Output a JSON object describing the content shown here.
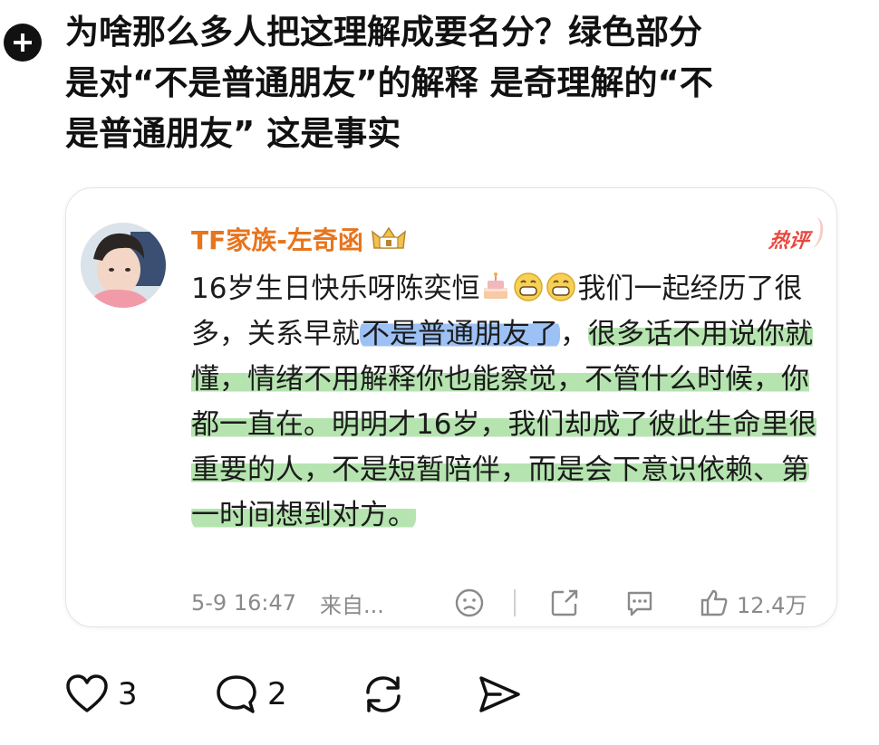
{
  "post": {
    "text": "为啥那么多人把这理解成要名分？绿色部分\n是对“不是普通朋友”的解释 是奇理解的“不\n是普通朋友” 这是事实"
  },
  "card": {
    "username": "TF家族-左奇函",
    "hot_badge": "热评",
    "comment": {
      "part1": "16岁生日快乐呀陈奕恒",
      "part2": "我们一起经历了很多，关系早就",
      "blue": "不是普通朋友了",
      "part3": "，",
      "green1": "很多话不用说你就懂，情绪不用解释你也能察觉，不管什么时候，你都一直在。明明才16岁，我们却成了彼此生命里很重要的人，不是短暂陪伴，而是会下意识依赖、第",
      "newline_after": "",
      "green2": "一时间想到对方。"
    },
    "footer": {
      "time": "5-9 16:47",
      "source": "来自...",
      "likes": "12.4万"
    }
  },
  "actions": {
    "likes": "3",
    "comments": "2"
  },
  "colors": {
    "username": "#e8741c",
    "hot_badge": "#e8473e",
    "highlight_blue": "#68a0f0",
    "highlight_green": "#78cd6e"
  }
}
